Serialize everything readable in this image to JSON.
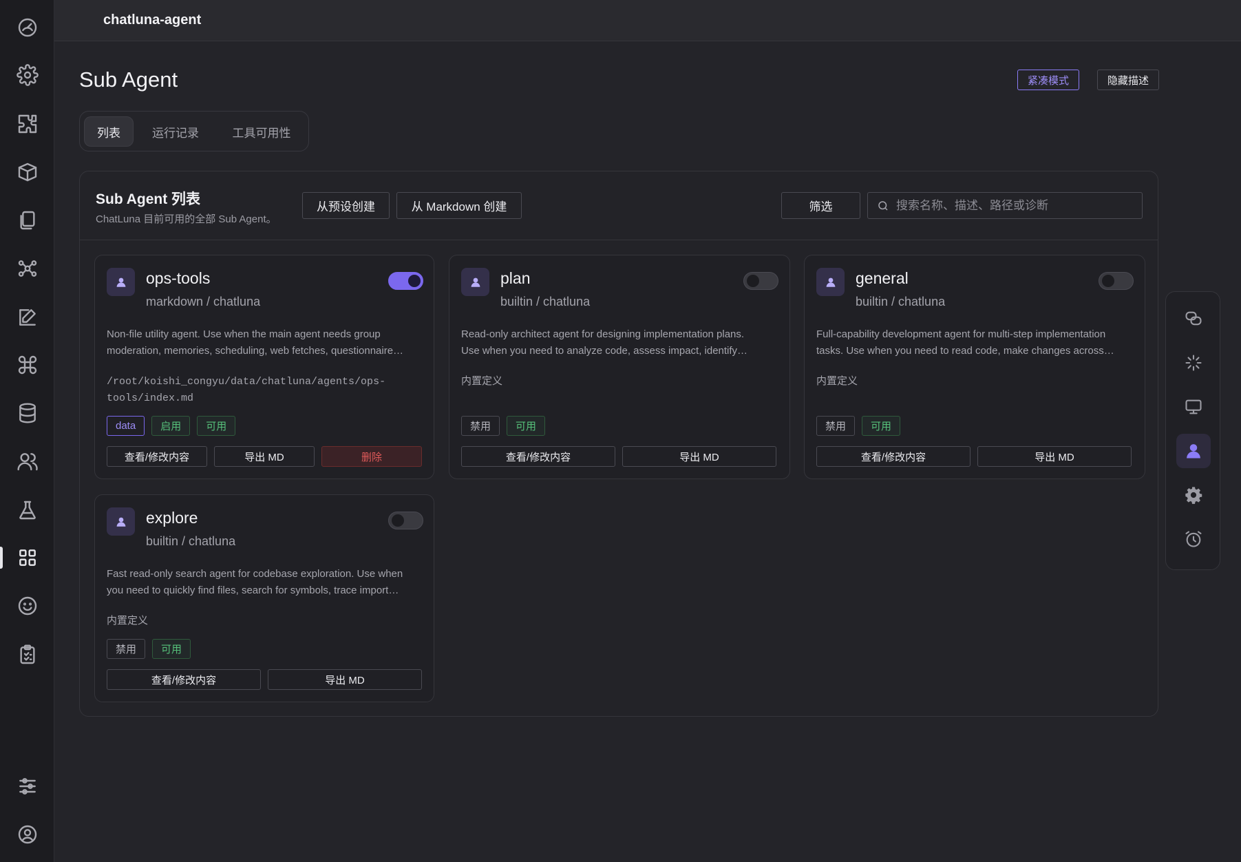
{
  "app": {
    "title": "chatluna-agent"
  },
  "page": {
    "title": "Sub Agent"
  },
  "header_buttons": {
    "compact": "紧凑模式",
    "hide_desc": "隐藏描述"
  },
  "tabs": [
    {
      "label": "列表",
      "active": true
    },
    {
      "label": "运行记录",
      "active": false
    },
    {
      "label": "工具可用性",
      "active": false
    }
  ],
  "panel": {
    "title": "Sub Agent 列表",
    "subtitle": "ChatLuna 目前可用的全部 Sub Agent。",
    "create_preset": "从预设创建",
    "create_markdown": "从 Markdown 创建",
    "filter": "筛选",
    "search_placeholder": "搜索名称、描述、路径或诊断"
  },
  "cards": [
    {
      "name": "ops-tools",
      "source": "markdown / chatluna",
      "enabled": true,
      "desc1": "Non-file utility agent. Use when the main agent needs group",
      "desc2": "moderation, memories, scheduling, web fetches, questionnaire…",
      "path1": "/root/koishi_congyu/data/chatluna/agents/ops-",
      "path2": "tools/index.md",
      "badges": [
        "data",
        "启用",
        "可用"
      ],
      "btn_view": "查看/修改内容",
      "btn_export": "导出 MD",
      "btn_delete": "删除"
    },
    {
      "name": "plan",
      "source": "builtin / chatluna",
      "enabled": false,
      "desc1": "Read-only architect agent for designing implementation plans.",
      "desc2": "Use when you need to analyze code, assess impact, identify…",
      "path1": "内置定义",
      "badges": [
        "禁用",
        "可用"
      ],
      "btn_view": "查看/修改内容",
      "btn_export": "导出 MD"
    },
    {
      "name": "general",
      "source": "builtin / chatluna",
      "enabled": false,
      "desc1": "Full-capability development agent for multi-step implementation",
      "desc2": "tasks. Use when you need to read code, make changes across…",
      "path1": "内置定义",
      "badges": [
        "禁用",
        "可用"
      ],
      "btn_view": "查看/修改内容",
      "btn_export": "导出 MD"
    },
    {
      "name": "explore",
      "source": "builtin / chatluna",
      "enabled": false,
      "desc1": "Fast read-only search agent for codebase exploration. Use when",
      "desc2": "you need to quickly find files, search for symbols, trace import…",
      "path1": "内置定义",
      "badges": [
        "禁用",
        "可用"
      ],
      "btn_view": "查看/修改内容",
      "btn_export": "导出 MD"
    }
  ],
  "rail_icons": [
    "dashboard-icon",
    "settings-icon",
    "plugin-icon",
    "package-icon",
    "files-icon",
    "network-icon",
    "edit-icon",
    "command-icon",
    "database-icon",
    "users-icon",
    "lab-icon",
    "apps-icon",
    "emoji-icon",
    "clipboard-icon",
    "sliders-icon",
    "account-icon"
  ],
  "right_toolbar_icons": [
    "chat-icon",
    "loading-icon",
    "monitor-icon",
    "user-icon",
    "gear-icon",
    "alarm-icon"
  ],
  "colors": {
    "accent": "#7b68ee",
    "available": "#56c07a",
    "danger": "#e05a5a"
  }
}
